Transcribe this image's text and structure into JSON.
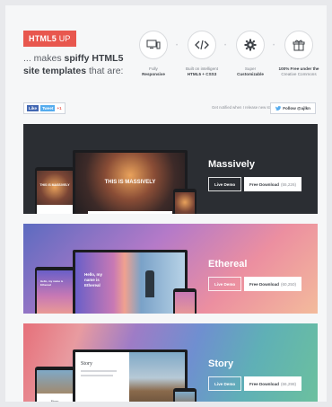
{
  "brand": {
    "name": "HTML5",
    "suffix": "UP"
  },
  "tagline": {
    "prefix": "... makes ",
    "bold": "spiffy HTML5 site templates",
    "suffix": " that are:"
  },
  "features": [
    {
      "icon": "responsive-devices-icon",
      "line1": "Fully",
      "line2": "Responsive"
    },
    {
      "icon": "code-icon",
      "line1": "Built on intelligent",
      "line2": "HTML5 + CSS3"
    },
    {
      "icon": "gear-icon",
      "line1": "Super",
      "line2": "Customizable"
    },
    {
      "icon": "gift-icon",
      "line1": "100% Free under the",
      "line2": "Creative Commons"
    }
  ],
  "social": {
    "like": "Like",
    "tweet": "Tweet",
    "gplus": "+1",
    "notify": "Get notified when I release new stuff:",
    "follow": "Follow @ajlkn"
  },
  "templates": [
    {
      "name": "Massively",
      "demo": "Live Demo",
      "download": "Free Download",
      "count": "(55,226)",
      "mock_title": "THIS IS MASSIVELY"
    },
    {
      "name": "Ethereal",
      "demo": "Live Demo",
      "download": "Free Download",
      "count": "(60,250)",
      "mock_title": "Hello, my name is Ethereal"
    },
    {
      "name": "Story",
      "demo": "Live Demo",
      "download": "Free Download",
      "count": "(66,298)",
      "mock_title": "Story"
    }
  ],
  "colors": {
    "brand": "#e8574e",
    "accent_twitter": "#55acee",
    "accent_facebook": "#4267b2"
  }
}
